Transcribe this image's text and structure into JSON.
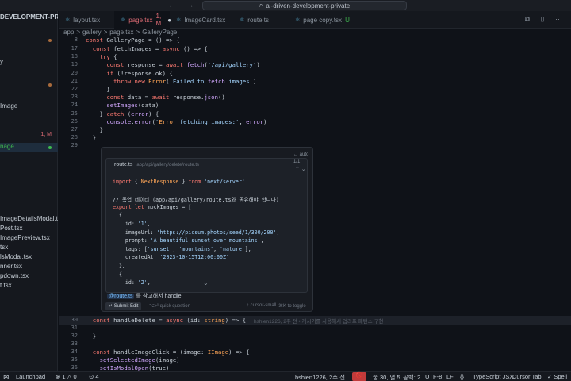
{
  "window": {
    "title": "ai-driven-development-private",
    "nav_arrows": "← →"
  },
  "sidebar": {
    "header": "DEVELOPMENT-PRIVATE",
    "items": [
      {
        "label": "",
        "dot": "orange"
      },
      {
        "label": "y",
        "dot": ""
      },
      {
        "label": "",
        "dot": "orange"
      },
      {
        "label": "Image",
        "dot": ""
      },
      {
        "label": "",
        "dot": ""
      },
      {
        "label": "",
        "badge": "1, M"
      },
      {
        "label": "nage",
        "dot": "green",
        "active": true
      },
      {
        "label": "ImageDetailsModal.tsx"
      },
      {
        "label": "Post.tsx"
      },
      {
        "label": "ImagePreview.tsx"
      },
      {
        "label": "tsx"
      },
      {
        "label": "lsModal.tsx"
      },
      {
        "label": "nner.tsx"
      },
      {
        "label": "pdown.tsx"
      },
      {
        "label": "t.tsx"
      }
    ]
  },
  "tabs": [
    {
      "label": "layout.tsx",
      "active": false,
      "status": ""
    },
    {
      "label": "page.tsx",
      "active": true,
      "status": "1, M"
    },
    {
      "label": "ImageCard.tsx",
      "active": false,
      "status": ""
    },
    {
      "label": "route.ts",
      "active": false,
      "status": ""
    },
    {
      "label": "page copy.tsx",
      "active": false,
      "status": "U"
    }
  ],
  "breadcrumb": [
    "app",
    "gallery",
    "page.tsx",
    "GalleryPage"
  ],
  "editor": {
    "lines_top": [
      {
        "n": "8",
        "text": "const GalleryPage = () => {"
      },
      {
        "n": "17",
        "text": "  const fetchImages = async () => {"
      },
      {
        "n": "18",
        "text": "    try {"
      },
      {
        "n": "19",
        "text": "      const response = await fetch('/api/gallery')"
      },
      {
        "n": "20",
        "text": "      if (!response.ok) {"
      },
      {
        "n": "21",
        "text": "        throw new Error('Failed to fetch images')"
      },
      {
        "n": "22",
        "text": "      }"
      },
      {
        "n": "23",
        "text": "      const data = await response.json()"
      },
      {
        "n": "24",
        "text": "      setImages(data)"
      },
      {
        "n": "25",
        "text": "    } catch (error) {"
      },
      {
        "n": "26",
        "text": "      console.error('Error fetching images:', error)"
      },
      {
        "n": "27",
        "text": "    }"
      },
      {
        "n": "28",
        "text": "  }"
      },
      {
        "n": "29",
        "text": ""
      }
    ],
    "lines_bottom": [
      {
        "n": "30",
        "text": "  const handleDelete = async (id: string) => {"
      },
      {
        "n": "31",
        "text": ""
      },
      {
        "n": "32",
        "text": "  }"
      },
      {
        "n": "33",
        "text": ""
      },
      {
        "n": "34",
        "text": "  const handleImageClick = (image: IImage) => {"
      },
      {
        "n": "35",
        "text": "    setSelectedImage(image)"
      },
      {
        "n": "36",
        "text": "    setIsModalOpen(true)"
      }
    ],
    "ghost_text": "hshien1226, 2주 전 • 게시기를 사용해서 업리프 패턴스 구현"
  },
  "peek": {
    "file_name": "route.ts",
    "file_path": "app/api/gallery/delete/route.ts",
    "top_right_1": "← auto",
    "top_right_2": "1/1",
    "top_right_3": "⌃ ⌄",
    "code": [
      "import { NextResponse } from 'next/server'",
      "",
      "// 목업 데이터 (app/api/gallery/route.ts와 공유해야 합니다)",
      "export let mockImages = [",
      "  {",
      "    id: '1',",
      "    imageUrl: 'https://picsum.photos/seed/1/300/200',",
      "    prompt: 'A beautiful sunset over mountains',",
      "    tags: ['sunset', 'mountains', 'nature'],",
      "    createdAt: '2023-10-15T12:00:00Z'",
      "  },",
      "  {",
      "    id: '2',"
    ],
    "chevron": "⌄",
    "chat_tag": "@route.ts",
    "chat_text": " 를 참고해서 handle",
    "submit_label": "↵ Submit Edit",
    "quick_label": "⌥⏎ quick question",
    "alt_label": "↑ cursor-small",
    "toggle_label": "⌘K to toggle"
  },
  "status": {
    "remote": "⋈",
    "branch": "Launchpad",
    "problems": "⊗ 1 △ 0",
    "ports": "⊙ 4",
    "blame": "hshien1226, 2주 전",
    "error_badge": "🚫",
    "position": "줄 30, 열 5",
    "spaces": "공백: 2",
    "encoding": "UTF-8",
    "eol": "LF",
    "brace": "{}",
    "language": "TypeScript JSX",
    "cursor_tab": "Cursor Tab",
    "spell": "✓ Spell"
  },
  "colors": {
    "accent_tab": "#e06c75",
    "keyword": "#ff7b72",
    "string": "#a5d6ff",
    "function": "#d2a8ff"
  }
}
